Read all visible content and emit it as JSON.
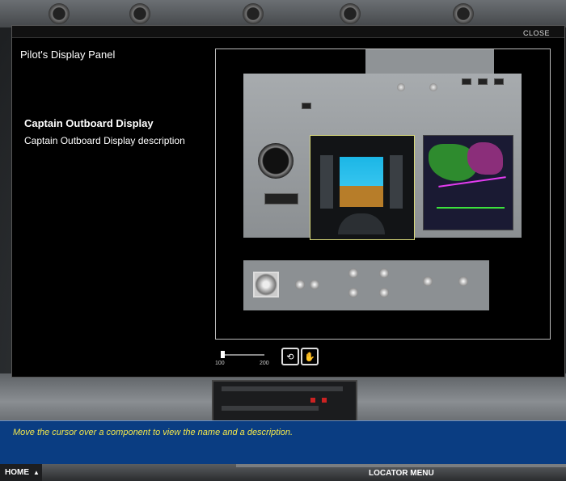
{
  "dialog": {
    "title": "Pilot's Display Panel",
    "close_label": "CLOSE",
    "component_name": "Captain Outboard Display",
    "component_description": "Captain Outboard Display description"
  },
  "viewer": {
    "zoom_min": "100",
    "zoom_max": "200",
    "zoom_level": 100,
    "tools": [
      {
        "icon": "rotate-icon",
        "glyph": "⟲"
      },
      {
        "icon": "hand-pan-icon",
        "glyph": "✋"
      }
    ]
  },
  "info_bar": {
    "text": "Move the cursor over a component to view the name and a description."
  },
  "footer": {
    "home_label": "HOME",
    "home_arrow": "▲",
    "locator_label": "LOCATOR MENU"
  },
  "colors": {
    "info_bar_bg": "#0a3d82",
    "info_text": "#f3e74b",
    "pfd_sky": "#1bb6e6",
    "pfd_ground": "#b77d29"
  }
}
